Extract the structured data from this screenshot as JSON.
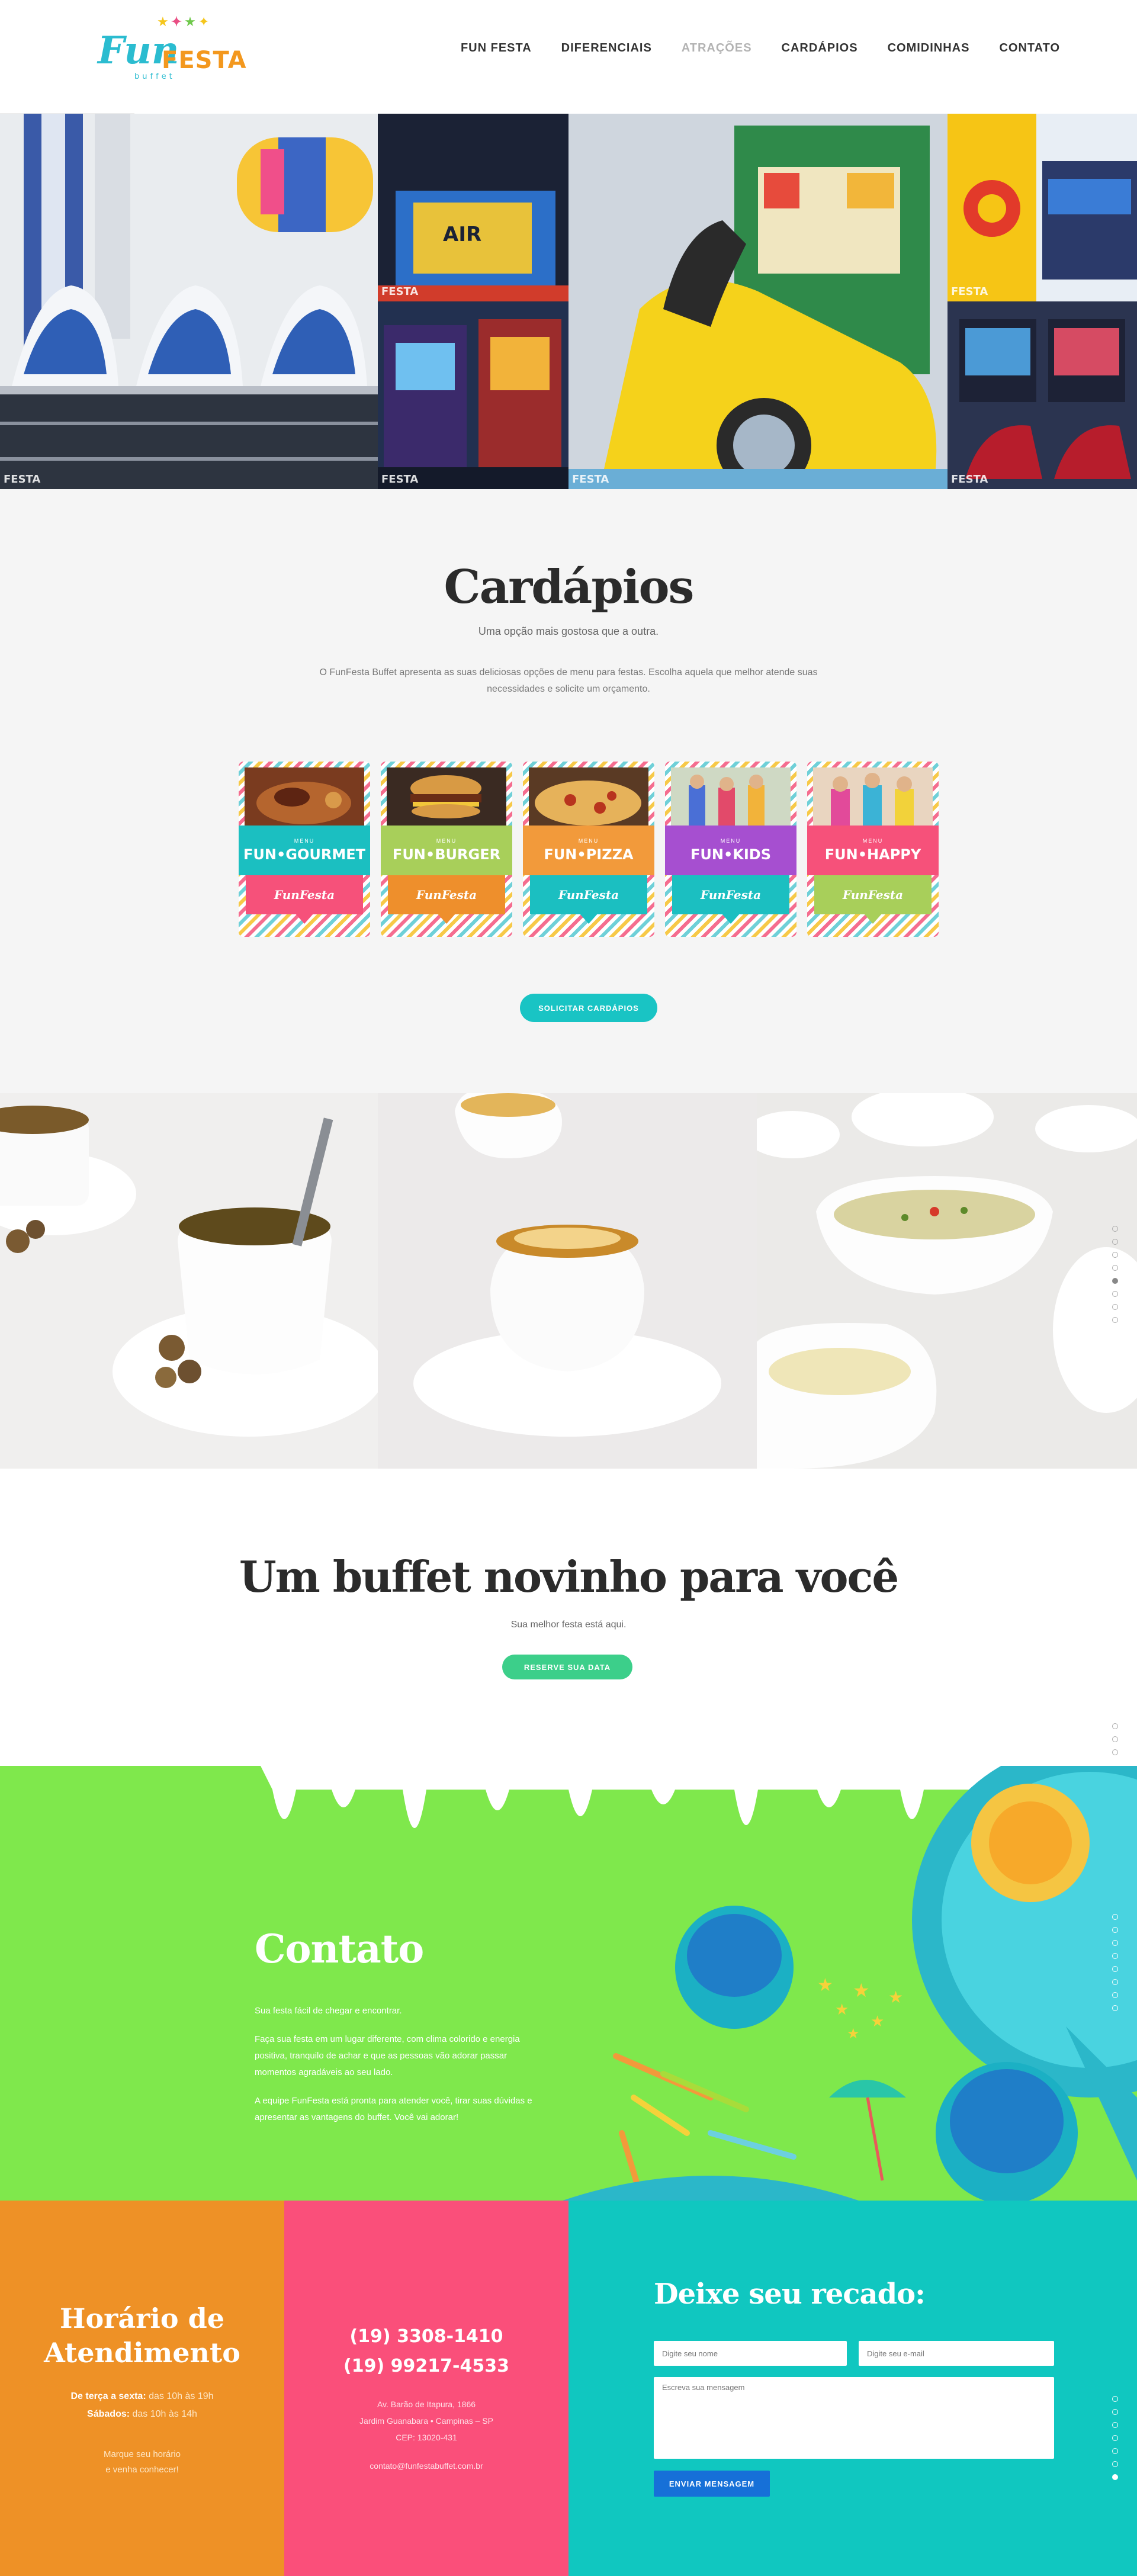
{
  "header": {
    "logo": {
      "fun": "Fun",
      "festa": "FESTA",
      "buffet": "buffet"
    },
    "nav": [
      {
        "label": "FUN FESTA"
      },
      {
        "label": "DIFERENCIAIS"
      },
      {
        "label": "ATRAÇÕES",
        "active": true
      },
      {
        "label": "CARDÁPIOS"
      },
      {
        "label": "COMIDINHAS"
      },
      {
        "label": "CONTATO"
      }
    ]
  },
  "gallery": {
    "watermark": "FESTA"
  },
  "cardapios": {
    "title": "Cardápios",
    "subtitle": "Uma opção mais gostosa que a outra.",
    "description": "O FunFesta Buffet apresenta as suas deliciosas opções de menu para festas. Escolha aquela que melhor atende suas necessidades e solicite um orçamento.",
    "menus": [
      {
        "pre": "MENU",
        "name": "FUN•GOURMET",
        "band_color": "#1bbfc1",
        "tab_color": "#f6517a",
        "tab_label": "FunFesta"
      },
      {
        "pre": "MENU",
        "name": "FUN•BURGER",
        "band_color": "#a8cf5a",
        "tab_color": "#ee8f2c",
        "tab_label": "FunFesta"
      },
      {
        "pre": "MENU",
        "name": "FUN•PIZZA",
        "band_color": "#f29a3b",
        "tab_color": "#1bbfc1",
        "tab_label": "FunFesta"
      },
      {
        "pre": "MENU",
        "name": "FUN•KIDS",
        "band_color": "#a64fd0",
        "tab_color": "#1bbfc1",
        "tab_label": "FunFesta"
      },
      {
        "pre": "MENU",
        "name": "FUN•HAPPY",
        "band_color": "#f6517a",
        "tab_color": "#a8cf5a",
        "tab_label": "FunFesta"
      }
    ],
    "button": "SOLICITAR CARDÁPIOS"
  },
  "buffet": {
    "title": "Um buffet novinho para você",
    "subtitle": "Sua melhor festa está aqui.",
    "button": "RESERVE SUA DATA"
  },
  "contato": {
    "title": "Contato",
    "p1": "Sua festa fácil de chegar e encontrar.",
    "p2": "Faça sua festa em um lugar diferente, com clima colorido e energia positiva, tranquilo de achar e que as pessoas vão adorar passar momentos agradáveis ao seu lado.",
    "p3": "A equipe FunFesta está pronta para atender você, tirar suas dúvidas e apresentar as vantagens do buffet. Você vai adorar!"
  },
  "horario": {
    "title_line1": "Horário de",
    "title_line2": "Atendimento",
    "weekday_label": "De terça a sexta:",
    "weekday_hours": " das 10h às 19h",
    "saturday_label": "Sábados:",
    "saturday_hours": " das 10h às 14h",
    "cta_line1": "Marque seu horário",
    "cta_line2": "e venha conhecer!"
  },
  "contact_info": {
    "phone1": "(19) 3308-1410",
    "phone2": "(19) 99217-4533",
    "address1": "Av. Barão de Itapura, 1866",
    "address2": "Jardim Guanabara • Campinas – SP",
    "cep": "CEP: 13020-431",
    "email": "contato@funfestabuffet.com.br"
  },
  "form": {
    "title": "Deixe seu recado:",
    "name_placeholder": "Digite seu nome",
    "email_placeholder": "Digite seu e-mail",
    "message_placeholder": "Escreva sua mensagem",
    "submit": "ENVIAR MENSAGEM"
  }
}
